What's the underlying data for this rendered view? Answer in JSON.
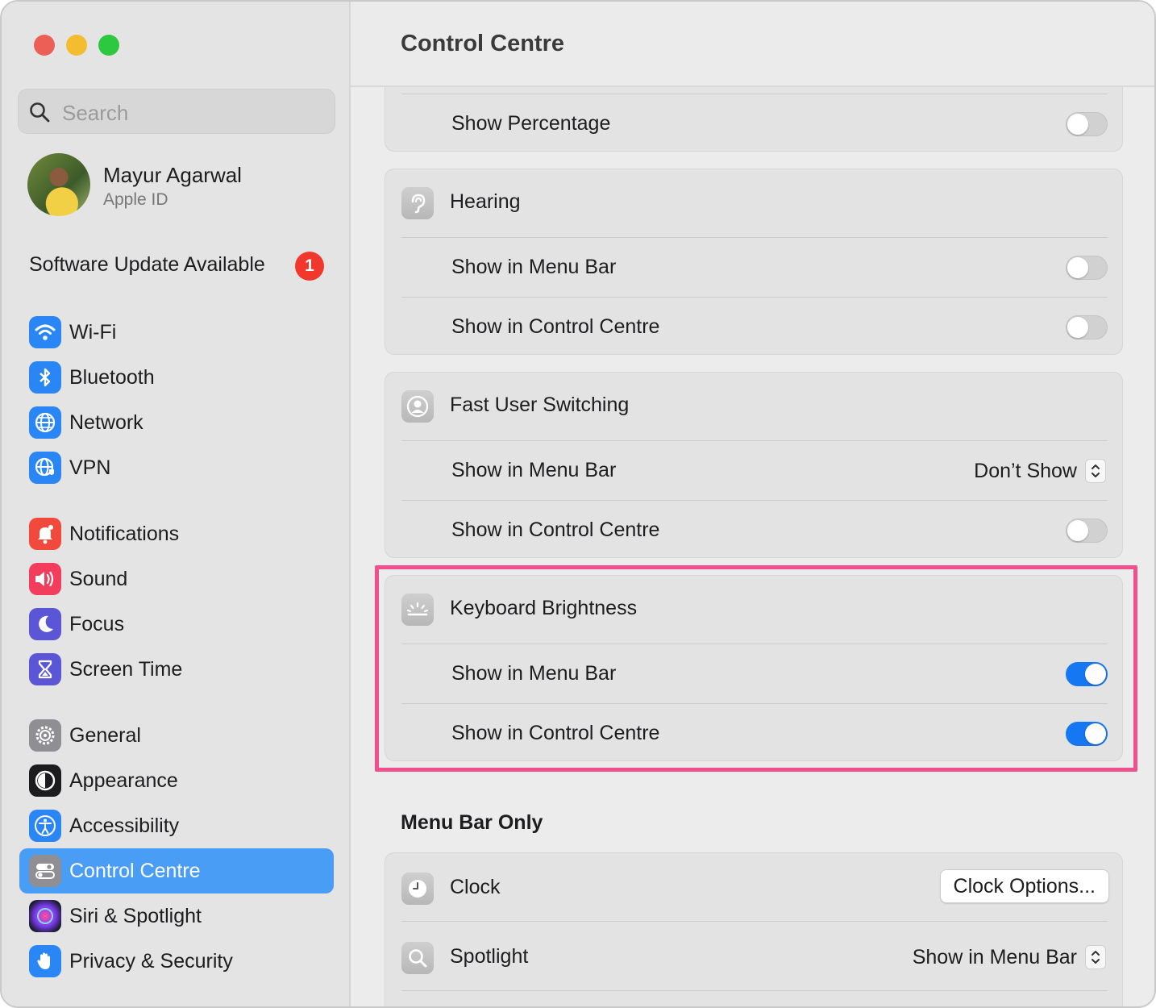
{
  "window": {
    "title": "Control Centre"
  },
  "search": {
    "placeholder": "Search"
  },
  "user": {
    "name": "Mayur Agarwal",
    "subtitle": "Apple ID"
  },
  "software_update": {
    "label": "Software Update Available",
    "badge": "1"
  },
  "sidebar": {
    "items": [
      {
        "label": "Wi-Fi",
        "icon": "wifi-icon",
        "color": "#2a86f5"
      },
      {
        "label": "Bluetooth",
        "icon": "bluetooth-icon",
        "color": "#2a86f5"
      },
      {
        "label": "Network",
        "icon": "globe-icon",
        "color": "#2a86f5"
      },
      {
        "label": "VPN",
        "icon": "vpn-globe-icon",
        "color": "#2a86f5"
      },
      {
        "label": "Notifications",
        "icon": "bell-icon",
        "color": "#f2493d"
      },
      {
        "label": "Sound",
        "icon": "speaker-icon",
        "color": "#f23d5c"
      },
      {
        "label": "Focus",
        "icon": "moon-icon",
        "color": "#5a56d6"
      },
      {
        "label": "Screen Time",
        "icon": "hourglass-icon",
        "color": "#5a56d6"
      },
      {
        "label": "General",
        "icon": "gear-icon",
        "color": "#8e8e93"
      },
      {
        "label": "Appearance",
        "icon": "appearance-icon",
        "color": "#1c1c1e"
      },
      {
        "label": "Accessibility",
        "icon": "accessibility-icon",
        "color": "#2a86f5"
      },
      {
        "label": "Control Centre",
        "icon": "control-centre-icon",
        "color": "#8e8e93",
        "active": true
      },
      {
        "label": "Siri & Spotlight",
        "icon": "siri-icon",
        "color": "#c03ad0"
      },
      {
        "label": "Privacy & Security",
        "icon": "hand-icon",
        "color": "#2a86f5"
      }
    ]
  },
  "main": {
    "battery_card": {
      "show_percentage_label": "Show Percentage",
      "show_percentage_on": false
    },
    "hearing": {
      "title": "Hearing",
      "menu_bar_label": "Show in Menu Bar",
      "menu_bar_on": false,
      "control_centre_label": "Show in Control Centre",
      "control_centre_on": false
    },
    "fast_user_switching": {
      "title": "Fast User Switching",
      "menu_bar_label": "Show in Menu Bar",
      "menu_bar_value": "Don’t Show",
      "control_centre_label": "Show in Control Centre",
      "control_centre_on": false
    },
    "keyboard_brightness": {
      "title": "Keyboard Brightness",
      "menu_bar_label": "Show in Menu Bar",
      "menu_bar_on": true,
      "control_centre_label": "Show in Control Centre",
      "control_centre_on": true
    },
    "menu_bar_only": {
      "section_title": "Menu Bar Only",
      "clock_label": "Clock",
      "clock_button": "Clock Options...",
      "spotlight_label": "Spotlight",
      "spotlight_value": "Show in Menu Bar"
    }
  },
  "colors": {
    "accent": "#1677f2",
    "highlight": "#f2508c",
    "sidebar_selected": "#4a9df5",
    "badge": "#f2382c"
  }
}
